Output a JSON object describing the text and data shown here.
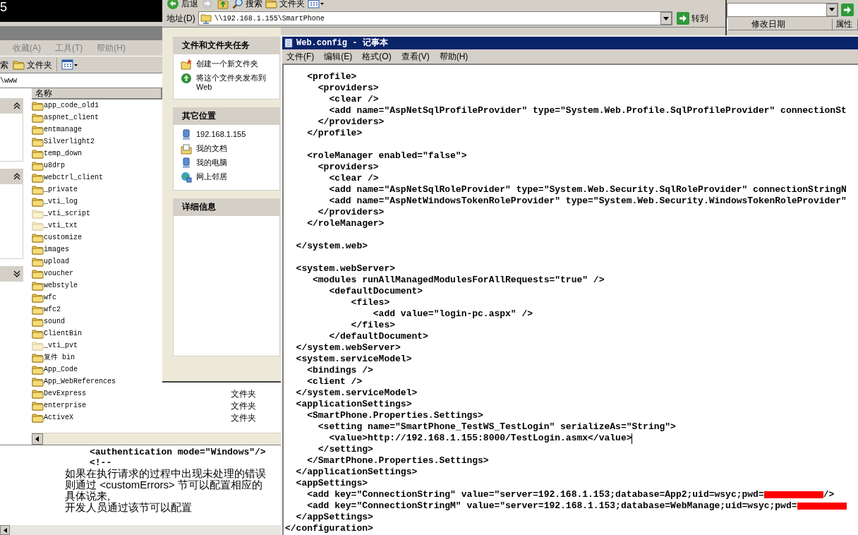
{
  "console": {
    "text": "5"
  },
  "left_explorer": {
    "menu": [
      "收藏(A)",
      "工具(T)",
      "帮助(H)"
    ],
    "toolbar": [
      {
        "kind": "search",
        "label": "索"
      },
      {
        "kind": "folders",
        "label": "文件夹"
      },
      {
        "kind": "views"
      }
    ],
    "address": "\\www",
    "task_panels": [
      {
        "expanded": true
      },
      {
        "expanded": true
      },
      {
        "expanded": false
      }
    ],
    "columns": [
      "名称"
    ],
    "files": [
      {
        "name": "app_code_old1",
        "hidden": false
      },
      {
        "name": "aspnet_client",
        "hidden": false
      },
      {
        "name": "entmanage",
        "hidden": false
      },
      {
        "name": "Silverlight2",
        "hidden": false
      },
      {
        "name": "temp_down",
        "hidden": false
      },
      {
        "name": "u8drp",
        "hidden": false
      },
      {
        "name": "webctrl_client",
        "hidden": false
      },
      {
        "name": "_private",
        "hidden": false
      },
      {
        "name": "_vti_log",
        "hidden": false
      },
      {
        "name": "_vti_script",
        "hidden": true
      },
      {
        "name": "_vti_txt",
        "hidden": true
      },
      {
        "name": "customize",
        "hidden": false
      },
      {
        "name": "images",
        "hidden": false
      },
      {
        "name": "upload",
        "hidden": false
      },
      {
        "name": "voucher",
        "hidden": false
      },
      {
        "name": "webstyle",
        "hidden": false
      },
      {
        "name": "wfc",
        "hidden": false
      },
      {
        "name": "wfc2",
        "hidden": false
      },
      {
        "name": "sound",
        "hidden": false
      },
      {
        "name": "ClientBin",
        "hidden": false
      },
      {
        "name": "_vti_pvt",
        "hidden": true
      },
      {
        "name": "复件 bin",
        "hidden": false
      },
      {
        "name": "App_Code",
        "hidden": false
      },
      {
        "name": "App_WebReferences",
        "hidden": false
      },
      {
        "name": "DevExpress",
        "hidden": false,
        "type": "文件夹"
      },
      {
        "name": "enterprise",
        "hidden": false,
        "type": "文件夹"
      },
      {
        "name": "ActiveX",
        "hidden": false,
        "type": "文件夹"
      }
    ]
  },
  "bottom_window": {
    "code_lines": [
      "<authentication mode=\"Windows\"/>",
      "<!--"
    ],
    "text_lines": [
      "如果在执行请求的过程中出现未处理的错误",
      "则通过 <customErrors> 节可以配置相应的",
      "具体说来,",
      "开发人员通过该节可以配置"
    ]
  },
  "back_explorer": {
    "columns": [
      "修改日期",
      "属性"
    ]
  },
  "share_explorer": {
    "toolbar": [
      {
        "kind": "back",
        "label": "后退"
      },
      {
        "kind": "forward"
      },
      {
        "kind": "up"
      },
      {
        "kind": "search",
        "label": "搜索"
      },
      {
        "kind": "folders",
        "label": "文件夹"
      },
      {
        "kind": "views"
      }
    ],
    "address_label": "地址(D)",
    "address": "\\\\192.168.1.155\\SmartPhone",
    "go": "转到",
    "panels": [
      {
        "title": "文件和文件夹任务",
        "items": [
          {
            "kind": "new-folder",
            "label": "创建一个新文件夹"
          },
          {
            "kind": "publish",
            "label": "将这个文件夹发布到 Web"
          }
        ]
      },
      {
        "title": "其它位置",
        "items": [
          {
            "kind": "computer",
            "label": "192.168.1.155"
          },
          {
            "kind": "documents",
            "label": "我的文档"
          },
          {
            "kind": "computer",
            "label": "我的电脑"
          },
          {
            "kind": "network",
            "label": "网上邻居"
          }
        ]
      },
      {
        "title": "详细信息"
      }
    ]
  },
  "notepad": {
    "title": "Web.config - 记事本",
    "menu": [
      "文件(F)",
      "编辑(E)",
      "格式(O)",
      "查看(V)",
      "帮助(H)"
    ],
    "lines": [
      {
        "kind": "code",
        "text": "    <profile>"
      },
      {
        "kind": "code",
        "text": "      <providers>"
      },
      {
        "kind": "code",
        "text": "        <clear />"
      },
      {
        "kind": "code",
        "text": "        <add name=\"AspNetSqlProfileProvider\" type=\"System.Web.Profile.SqlProfileProvider\" connectionSt"
      },
      {
        "kind": "code",
        "text": "      </providers>"
      },
      {
        "kind": "code",
        "text": "    </profile>"
      },
      {
        "kind": "blank"
      },
      {
        "kind": "code",
        "text": "    <roleManager enabled=\"false\">"
      },
      {
        "kind": "code",
        "text": "      <providers>"
      },
      {
        "kind": "code",
        "text": "        <clear />"
      },
      {
        "kind": "code",
        "text": "        <add name=\"AspNetSqlRoleProvider\" type=\"System.Web.Security.SqlRoleProvider\" connectionStringN"
      },
      {
        "kind": "code",
        "text": "        <add name=\"AspNetWindowsTokenRoleProvider\" type=\"System.Web.Security.WindowsTokenRoleProvider\""
      },
      {
        "kind": "code",
        "text": "      </providers>"
      },
      {
        "kind": "code",
        "text": "    </roleManager>"
      },
      {
        "kind": "blank"
      },
      {
        "kind": "code",
        "text": "  </system.web>"
      },
      {
        "kind": "blank"
      },
      {
        "kind": "code",
        "text": "  <system.webServer>"
      },
      {
        "kind": "code",
        "text": "     <modules runAllManagedModulesForAllRequests=\"true\" />"
      },
      {
        "kind": "code",
        "text": "        <defaultDocument>"
      },
      {
        "kind": "code",
        "text": "            <files>"
      },
      {
        "kind": "code",
        "text": "                <add value=\"login-pc.aspx\" />"
      },
      {
        "kind": "code",
        "text": "            </files>"
      },
      {
        "kind": "code",
        "text": "        </defaultDocument>"
      },
      {
        "kind": "code",
        "text": "  </system.webServer>"
      },
      {
        "kind": "code",
        "text": "  <system.serviceModel>"
      },
      {
        "kind": "code",
        "text": "    <bindings />"
      },
      {
        "kind": "code",
        "text": "    <client />"
      },
      {
        "kind": "code",
        "text": "  </system.serviceModel>"
      },
      {
        "kind": "code",
        "text": "  <applicationSettings>"
      },
      {
        "kind": "code",
        "text": "    <SmartPhone.Properties.Settings>"
      },
      {
        "kind": "code",
        "text": "      <setting name=\"SmartPhone_TestWS_TestLogin\" serializeAs=\"String\">"
      },
      {
        "kind": "code",
        "text": "        <value>http://192.168.1.155:8000/TestLogin.asmx</value>",
        "caret": true
      },
      {
        "kind": "code",
        "text": "      </setting>"
      },
      {
        "kind": "code",
        "text": "    </SmartPhone.Properties.Settings>"
      },
      {
        "kind": "code",
        "text": "  </applicationSettings>"
      },
      {
        "kind": "code",
        "text": "  <appSettings>"
      },
      {
        "kind": "code",
        "text": "    <add key=\"ConnectionString\" value=\"server=192.168.1.153;database=App2;uid=wsyc;pwd=",
        "redacted": true,
        "tail": "/>"
      },
      {
        "kind": "code",
        "text": "    <add key=\"ConnectionStringM\" value=\"server=192.168.1.153;database=WebManage;uid=wsyc;pwd=",
        "redacted": true
      },
      {
        "kind": "code",
        "text": "  </appSettings>"
      },
      {
        "kind": "code",
        "text": "</configuration>"
      }
    ]
  }
}
